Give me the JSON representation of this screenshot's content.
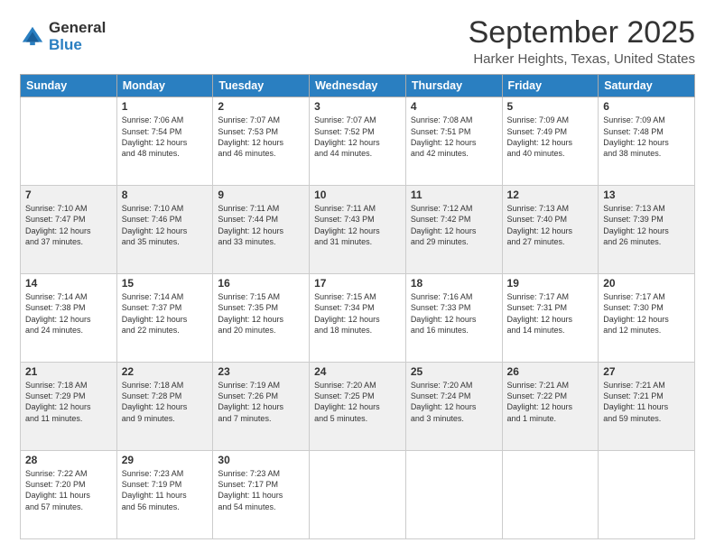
{
  "logo": {
    "general": "General",
    "blue": "Blue"
  },
  "header": {
    "month": "September 2025",
    "location": "Harker Heights, Texas, United States"
  },
  "weekdays": [
    "Sunday",
    "Monday",
    "Tuesday",
    "Wednesday",
    "Thursday",
    "Friday",
    "Saturday"
  ],
  "weeks": [
    [
      {
        "day": "",
        "info": ""
      },
      {
        "day": "1",
        "info": "Sunrise: 7:06 AM\nSunset: 7:54 PM\nDaylight: 12 hours\nand 48 minutes."
      },
      {
        "day": "2",
        "info": "Sunrise: 7:07 AM\nSunset: 7:53 PM\nDaylight: 12 hours\nand 46 minutes."
      },
      {
        "day": "3",
        "info": "Sunrise: 7:07 AM\nSunset: 7:52 PM\nDaylight: 12 hours\nand 44 minutes."
      },
      {
        "day": "4",
        "info": "Sunrise: 7:08 AM\nSunset: 7:51 PM\nDaylight: 12 hours\nand 42 minutes."
      },
      {
        "day": "5",
        "info": "Sunrise: 7:09 AM\nSunset: 7:49 PM\nDaylight: 12 hours\nand 40 minutes."
      },
      {
        "day": "6",
        "info": "Sunrise: 7:09 AM\nSunset: 7:48 PM\nDaylight: 12 hours\nand 38 minutes."
      }
    ],
    [
      {
        "day": "7",
        "info": "Sunrise: 7:10 AM\nSunset: 7:47 PM\nDaylight: 12 hours\nand 37 minutes."
      },
      {
        "day": "8",
        "info": "Sunrise: 7:10 AM\nSunset: 7:46 PM\nDaylight: 12 hours\nand 35 minutes."
      },
      {
        "day": "9",
        "info": "Sunrise: 7:11 AM\nSunset: 7:44 PM\nDaylight: 12 hours\nand 33 minutes."
      },
      {
        "day": "10",
        "info": "Sunrise: 7:11 AM\nSunset: 7:43 PM\nDaylight: 12 hours\nand 31 minutes."
      },
      {
        "day": "11",
        "info": "Sunrise: 7:12 AM\nSunset: 7:42 PM\nDaylight: 12 hours\nand 29 minutes."
      },
      {
        "day": "12",
        "info": "Sunrise: 7:13 AM\nSunset: 7:40 PM\nDaylight: 12 hours\nand 27 minutes."
      },
      {
        "day": "13",
        "info": "Sunrise: 7:13 AM\nSunset: 7:39 PM\nDaylight: 12 hours\nand 26 minutes."
      }
    ],
    [
      {
        "day": "14",
        "info": "Sunrise: 7:14 AM\nSunset: 7:38 PM\nDaylight: 12 hours\nand 24 minutes."
      },
      {
        "day": "15",
        "info": "Sunrise: 7:14 AM\nSunset: 7:37 PM\nDaylight: 12 hours\nand 22 minutes."
      },
      {
        "day": "16",
        "info": "Sunrise: 7:15 AM\nSunset: 7:35 PM\nDaylight: 12 hours\nand 20 minutes."
      },
      {
        "day": "17",
        "info": "Sunrise: 7:15 AM\nSunset: 7:34 PM\nDaylight: 12 hours\nand 18 minutes."
      },
      {
        "day": "18",
        "info": "Sunrise: 7:16 AM\nSunset: 7:33 PM\nDaylight: 12 hours\nand 16 minutes."
      },
      {
        "day": "19",
        "info": "Sunrise: 7:17 AM\nSunset: 7:31 PM\nDaylight: 12 hours\nand 14 minutes."
      },
      {
        "day": "20",
        "info": "Sunrise: 7:17 AM\nSunset: 7:30 PM\nDaylight: 12 hours\nand 12 minutes."
      }
    ],
    [
      {
        "day": "21",
        "info": "Sunrise: 7:18 AM\nSunset: 7:29 PM\nDaylight: 12 hours\nand 11 minutes."
      },
      {
        "day": "22",
        "info": "Sunrise: 7:18 AM\nSunset: 7:28 PM\nDaylight: 12 hours\nand 9 minutes."
      },
      {
        "day": "23",
        "info": "Sunrise: 7:19 AM\nSunset: 7:26 PM\nDaylight: 12 hours\nand 7 minutes."
      },
      {
        "day": "24",
        "info": "Sunrise: 7:20 AM\nSunset: 7:25 PM\nDaylight: 12 hours\nand 5 minutes."
      },
      {
        "day": "25",
        "info": "Sunrise: 7:20 AM\nSunset: 7:24 PM\nDaylight: 12 hours\nand 3 minutes."
      },
      {
        "day": "26",
        "info": "Sunrise: 7:21 AM\nSunset: 7:22 PM\nDaylight: 12 hours\nand 1 minute."
      },
      {
        "day": "27",
        "info": "Sunrise: 7:21 AM\nSunset: 7:21 PM\nDaylight: 11 hours\nand 59 minutes."
      }
    ],
    [
      {
        "day": "28",
        "info": "Sunrise: 7:22 AM\nSunset: 7:20 PM\nDaylight: 11 hours\nand 57 minutes."
      },
      {
        "day": "29",
        "info": "Sunrise: 7:23 AM\nSunset: 7:19 PM\nDaylight: 11 hours\nand 56 minutes."
      },
      {
        "day": "30",
        "info": "Sunrise: 7:23 AM\nSunset: 7:17 PM\nDaylight: 11 hours\nand 54 minutes."
      },
      {
        "day": "",
        "info": ""
      },
      {
        "day": "",
        "info": ""
      },
      {
        "day": "",
        "info": ""
      },
      {
        "day": "",
        "info": ""
      }
    ]
  ]
}
